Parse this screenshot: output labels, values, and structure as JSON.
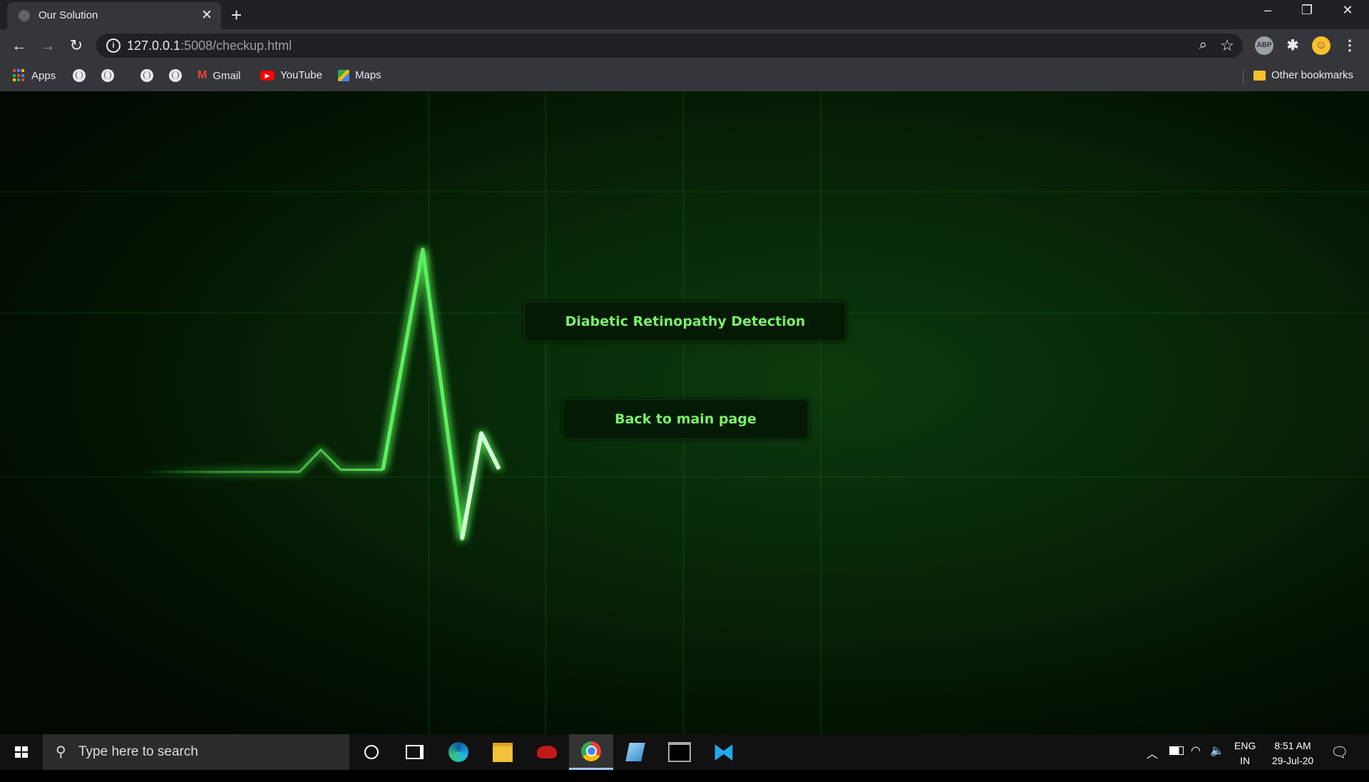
{
  "browser": {
    "tab_title": "Our Solution",
    "tab_close": "✕",
    "new_tab": "+",
    "url_host": "127.0.0.1",
    "url_rest": ":5008/checkup.html",
    "bookmarks": {
      "apps": "Apps",
      "gmail": "Gmail",
      "youtube": "YouTube",
      "maps": "Maps",
      "other": "Other bookmarks"
    },
    "window_controls": {
      "minimize": "–",
      "restore": "❐",
      "close": "✕"
    }
  },
  "page": {
    "primary_button": "Diabetic Retinopathy Detection",
    "secondary_button": "Back to main page",
    "accent_color": "#7cf06a"
  },
  "taskbar": {
    "search_placeholder": "Type here to search",
    "language_top": "ENG",
    "language_bottom": "IN",
    "time": "8:51 AM",
    "date": "29-Jul-20"
  }
}
